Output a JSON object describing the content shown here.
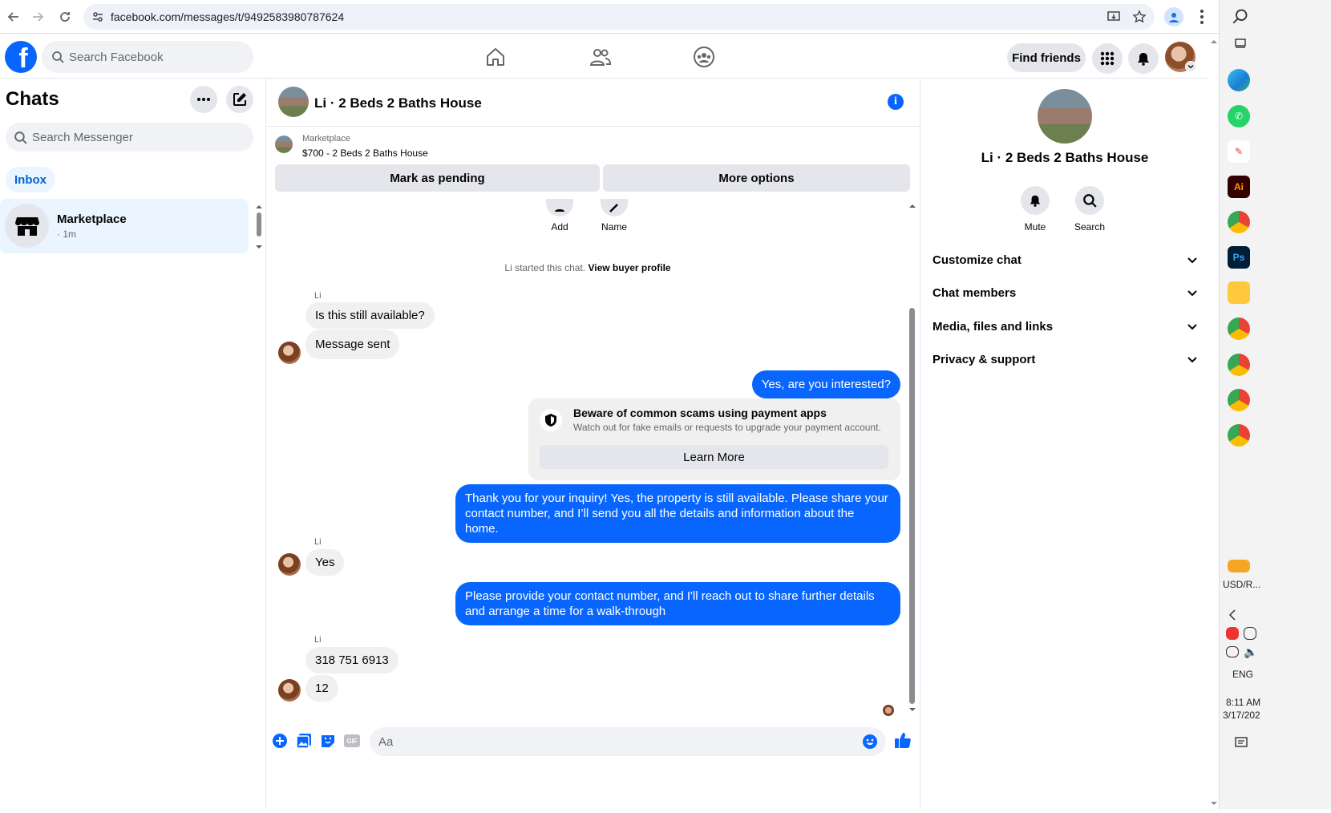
{
  "browser": {
    "url": "facebook.com/messages/t/9492583980787624"
  },
  "nav": {
    "search_placeholder": "Search Facebook",
    "find_friends": "Find friends"
  },
  "sidebar": {
    "title": "Chats",
    "search_placeholder": "Search Messenger",
    "filter": "Inbox",
    "chats": [
      {
        "name": "Marketplace",
        "time": "· 1m"
      }
    ]
  },
  "conversation": {
    "title": "Li · 2 Beds 2 Baths House",
    "listing_label": "Marketplace",
    "listing_price": "$700 - 2 Beds 2 Baths House",
    "mark_pending": "Mark as pending",
    "more_options": "More options",
    "top_actions": {
      "add": "Add",
      "name": "Name"
    },
    "started_text": "Li started this chat.",
    "buyer_profile_link": "View buyer profile",
    "messages": [
      {
        "sender": "Li",
        "text": "Is this still available?"
      },
      {
        "text": "Message sent"
      },
      {
        "me": true,
        "text": "Yes, are you interested?"
      },
      {
        "me": true,
        "text": "Thank you for your inquiry! Yes, the property is still available. Please share your contact number, and I’ll send you all the details and information about the home."
      },
      {
        "sender": "Li",
        "text": "Yes"
      },
      {
        "me": true,
        "text": "Please provide your contact number, and I'll reach out to share further details and arrange a time for a walk-through"
      },
      {
        "sender": "Li",
        "text": "318 751 6913"
      },
      {
        "text": "12"
      }
    ],
    "scam_card": {
      "title": "Beware of common scams using payment apps",
      "subtitle": "Watch out for fake emails or requests to upgrade your payment account.",
      "button": "Learn More"
    },
    "composer_placeholder": "Aa",
    "gif_label": "GIF"
  },
  "info_panel": {
    "title": "Li · 2 Beds 2 Baths House",
    "actions": {
      "mute": "Mute",
      "search": "Search"
    },
    "sections": [
      "Customize chat",
      "Chat members",
      "Media, files and links",
      "Privacy & support"
    ]
  },
  "os": {
    "currency": "USD/R...",
    "lang": "ENG",
    "time": "8:11 AM",
    "date": "3/17/202"
  },
  "colors": {
    "accent": "#0866ff",
    "bubble_in": "#f0f0f0",
    "selected": "#ebf5ff"
  }
}
